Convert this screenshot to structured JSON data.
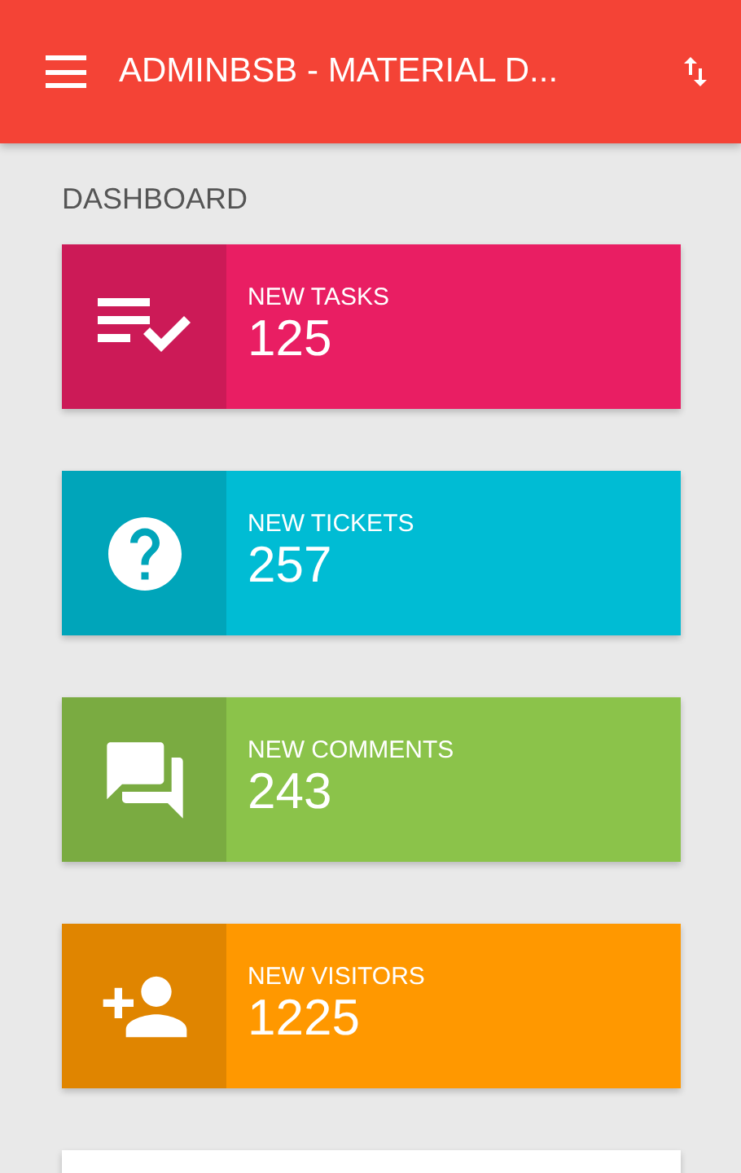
{
  "header": {
    "title": "ADMINBSB - MATERIAL D..."
  },
  "section_title": "DASHBOARD",
  "info_boxes": [
    {
      "kind": "tasks",
      "label": "NEW TASKS",
      "count": "125",
      "color": "#e91e63"
    },
    {
      "kind": "help",
      "label": "NEW TICKETS",
      "count": "257",
      "color": "#00bcd4"
    },
    {
      "kind": "comments",
      "label": "NEW COMMENTS",
      "count": "243",
      "color": "#8bc34a"
    },
    {
      "kind": "add-person",
      "label": "NEW VISITORS",
      "count": "1225",
      "color": "#ff9800"
    }
  ]
}
